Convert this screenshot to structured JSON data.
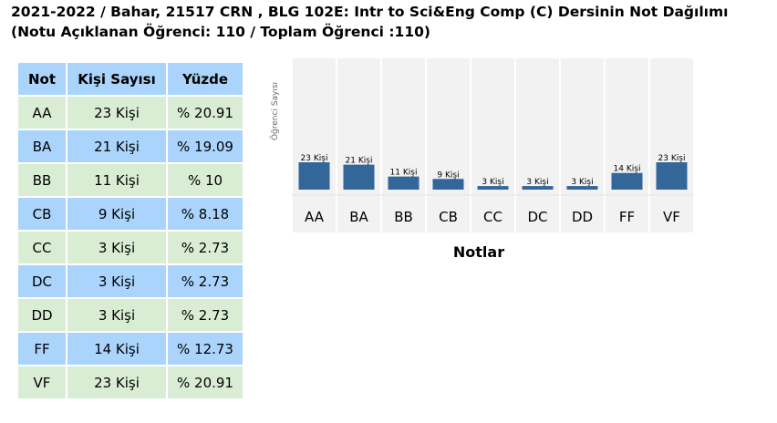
{
  "page": {
    "title_line1": "2021-2022 / Bahar, 21517 CRN , BLG 102E: Intr to Sci&Eng Comp (C) Dersinin Not Dağılımı",
    "title_line2": "(Notu Açıklanan Öğrenci: 110 / Toplam Öğrenci :110)"
  },
  "table": {
    "headers": [
      "Not",
      "Kişi Sayısı",
      "Yüzde"
    ],
    "rows": [
      [
        "AA",
        "23 Kişi",
        "% 20.91"
      ],
      [
        "BA",
        "21 Kişi",
        "% 19.09"
      ],
      [
        "BB",
        "11 Kişi",
        "% 10"
      ],
      [
        "CB",
        "9 Kişi",
        "% 8.18"
      ],
      [
        "CC",
        "3 Kişi",
        "% 2.73"
      ],
      [
        "DC",
        "3 Kişi",
        "% 2.73"
      ],
      [
        "DD",
        "3 Kişi",
        "% 2.73"
      ],
      [
        "FF",
        "14 Kişi",
        "% 12.73"
      ],
      [
        "VF",
        "23 Kişi",
        "% 20.91"
      ]
    ]
  },
  "colors": {
    "bar": "#336699",
    "plot_bg": "#f2f2f2",
    "row_green": "#d9edd4",
    "row_blue": "#aad4fb"
  },
  "chart_data": {
    "type": "bar",
    "categories": [
      "AA",
      "BA",
      "BB",
      "CB",
      "CC",
      "DC",
      "DD",
      "FF",
      "VF"
    ],
    "values": [
      23,
      21,
      11,
      9,
      3,
      3,
      3,
      14,
      23
    ],
    "data_labels": [
      "23 Kişi",
      "21 Kişi",
      "11 Kişi",
      "9 Kişi",
      "3 Kişi",
      "3 Kişi",
      "3 Kişi",
      "14 Kişi",
      "23 Kişi"
    ],
    "xlabel": "Notlar",
    "ylabel": "Öğrenci Sayısı",
    "grid": false,
    "legend": "none"
  }
}
